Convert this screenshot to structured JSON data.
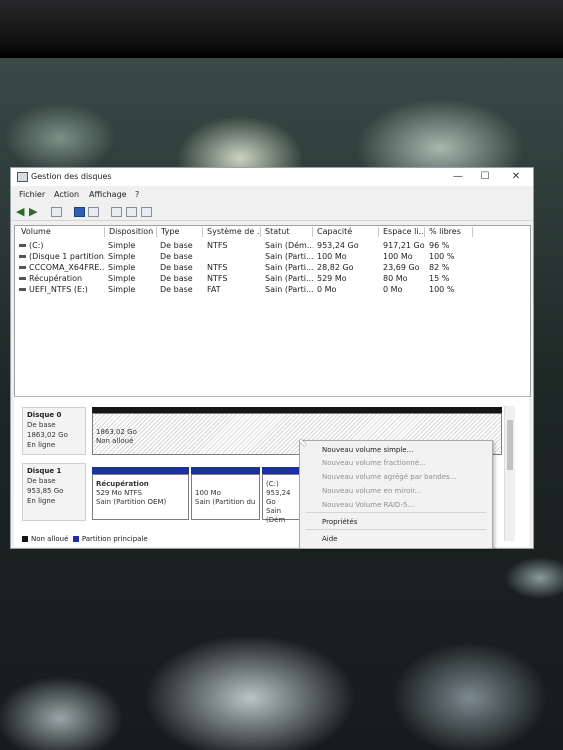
{
  "window": {
    "title": "Gestion des disques",
    "controls": {
      "minimize": "—",
      "maximize": "☐",
      "close": "✕"
    }
  },
  "menu": [
    "Fichier",
    "Action",
    "Affichage",
    "?"
  ],
  "volumes": {
    "columns": [
      "Volume",
      "Disposition",
      "Type",
      "Système de ...",
      "Statut",
      "Capacité",
      "Espace li...",
      "% libres"
    ],
    "rows": [
      [
        "(C:)",
        "Simple",
        "De base",
        "NTFS",
        "Sain (Dém...",
        "953,24 Go",
        "917,21 Go",
        "96 %"
      ],
      [
        "(Disque 1 partition...",
        "Simple",
        "De base",
        "",
        "Sain (Parti...",
        "100 Mo",
        "100 Mo",
        "100 %"
      ],
      [
        "CCCOMA_X64FRE...",
        "Simple",
        "De base",
        "NTFS",
        "Sain (Parti...",
        "28,82 Go",
        "23,69 Go",
        "82 %"
      ],
      [
        "Récupération",
        "Simple",
        "De base",
        "NTFS",
        "Sain (Parti...",
        "529 Mo",
        "80 Mo",
        "15 %"
      ],
      [
        "UEFI_NTFS (E:)",
        "Simple",
        "De base",
        "FAT",
        "Sain (Parti...",
        "0 Mo",
        "0 Mo",
        "100 %"
      ]
    ]
  },
  "disk0": {
    "name": "Disque 0",
    "type": "De base",
    "size": "1863,02 Go",
    "status": "En ligne",
    "partition": {
      "size": "1863,02 Go",
      "state": "Non alloué"
    }
  },
  "disk1": {
    "name": "Disque 1",
    "type": "De base",
    "size": "953,85 Go",
    "status": "En ligne",
    "partitions": [
      {
        "title": "Récupération",
        "line2": "529 Mo NTFS",
        "line3": "Sain (Partition OEM)"
      },
      {
        "title": "",
        "line2": "100 Mo",
        "line3": "Sain (Partition du"
      },
      {
        "title": "(C:)",
        "line2": "953,24 Go",
        "line3": "Sain (Dém"
      }
    ]
  },
  "legend": {
    "unallocated": "Non alloué",
    "primary": "Partition principale",
    "colors": {
      "unallocated": "#151515",
      "primary": "#1c2fa5"
    }
  },
  "context_menu": {
    "items": [
      "Nouveau volume simple...",
      "Nouveau volume fractionné...",
      "Nouveau volume agrégé par bandes...",
      "Nouveau volume en miroir...",
      "Nouveau Volume RAID-5..."
    ],
    "properties": "Propriétés",
    "help": "Aide"
  }
}
